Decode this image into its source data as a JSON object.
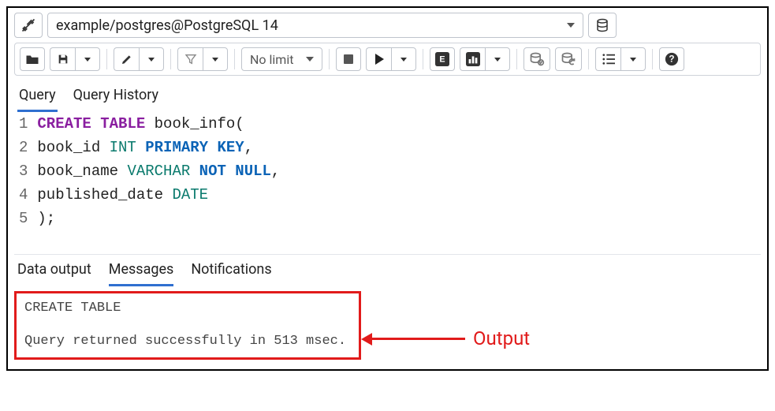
{
  "connection": {
    "label": "example/postgres@PostgreSQL 14"
  },
  "toolbar": {
    "limit_label": "No limit"
  },
  "tabs": {
    "query": "Query",
    "history": "Query History"
  },
  "sql": {
    "lines": [
      "1",
      "2",
      "3",
      "4",
      "5"
    ],
    "l1_kw1": "CREATE",
    "l1_kw2": "TABLE",
    "l1_rest": " book_info(",
    "l2_a": "book_id ",
    "l2_type": "INT",
    "l2_sp": " ",
    "l2_kw1": "PRIMARY",
    "l2_kw2": "KEY",
    "l2_end": ",",
    "l3_a": "book_name ",
    "l3_type": "VARCHAR",
    "l3_sp": " ",
    "l3_kw1": "NOT",
    "l3_kw2": "NULL",
    "l3_end": ",",
    "l4_a": "published_date ",
    "l4_type": "DATE",
    "l5": ");"
  },
  "out_tabs": {
    "data": "Data output",
    "messages": "Messages",
    "notif": "Notifications"
  },
  "messages": {
    "line1": "CREATE TABLE",
    "line2": "Query returned successfully in 513 msec."
  },
  "annotation": {
    "label": "Output"
  },
  "colors": {
    "accent": "#2f6fd0",
    "error_red": "#e11b1b"
  }
}
